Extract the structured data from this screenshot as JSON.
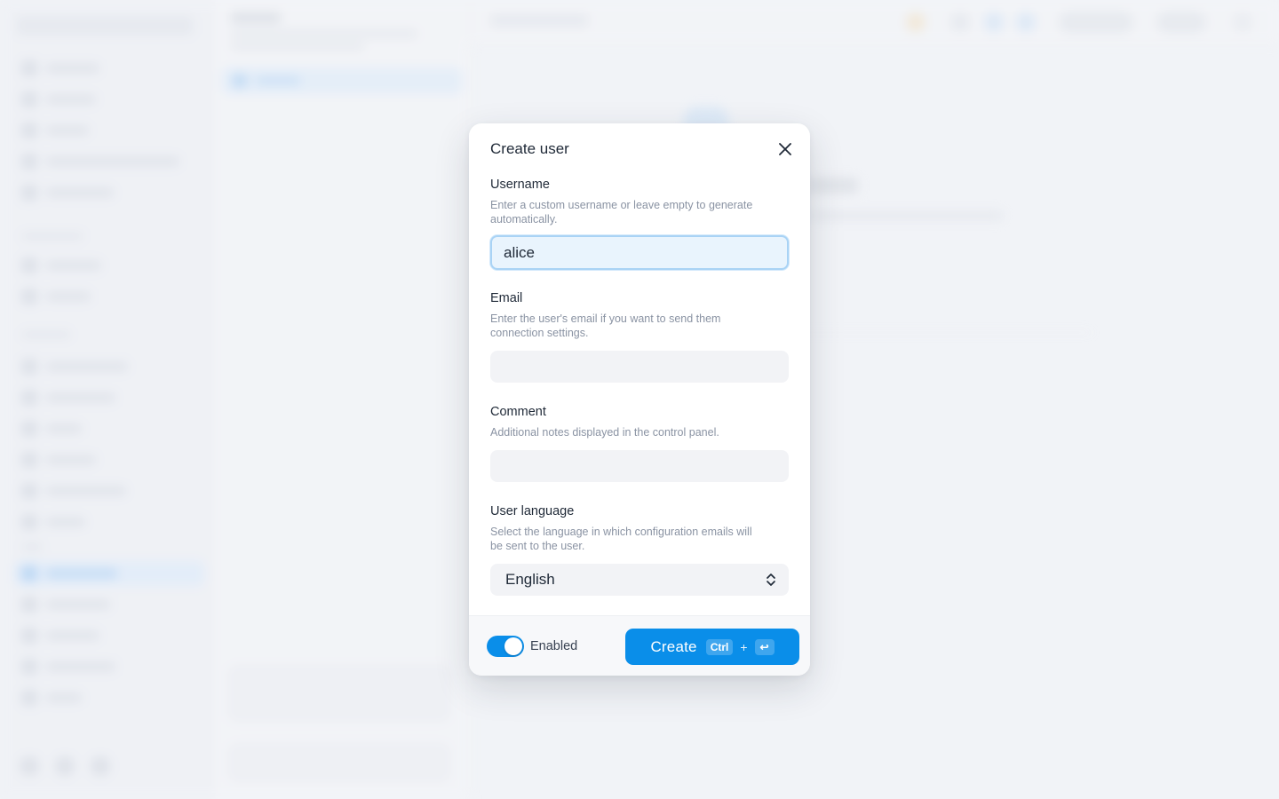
{
  "modal": {
    "title": "Create user",
    "username": {
      "label": "Username",
      "help": "Enter a custom username or leave empty to generate automatically.",
      "value": "alice"
    },
    "email": {
      "label": "Email",
      "help": "Enter the user's email if you want to send them connection settings.",
      "value": ""
    },
    "comment": {
      "label": "Comment",
      "help": "Additional notes displayed in the control panel.",
      "value": ""
    },
    "language": {
      "label": "User language",
      "help": "Select the language in which configuration emails will be sent to the user.",
      "value": "English"
    },
    "footer": {
      "enabled_label": "Enabled",
      "enabled": true,
      "create_label": "Create",
      "shortcut_key1": "Ctrl",
      "shortcut_plus": "+",
      "shortcut_key2": "↩"
    }
  },
  "icons": {
    "close": "close-icon",
    "select": "chevron-up-down-icon",
    "enter": "enter-key-icon"
  },
  "colors": {
    "accent": "#0a8ee9",
    "focus_bg": "#e9f4fd",
    "focus_border": "#a9d3f5",
    "input_bg": "#f2f3f6",
    "help_text": "#8a93a3"
  }
}
